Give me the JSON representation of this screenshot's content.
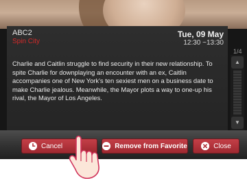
{
  "program_info": {
    "channel": "ABC2",
    "program_title": "Spin City",
    "date": "Tue, 09 May",
    "time_range": "12:30 ~13:30",
    "description": "Charlie and Caitlin struggle to find security in their new relationship. To spite Charlie for downplaying an encounter with an ex, Caitlin accompanies one of New York's ten sexiest men on a business date to make Charlie jealous. Meanwhile, the Mayor plots a way to one-up his rival, the Mayor of Los Angeles.",
    "page_indicator": "1/4"
  },
  "buttons": {
    "cancel": {
      "label": "Cancel",
      "icon": "clock-icon"
    },
    "remove_favorite": {
      "label": "Remove from Favorite",
      "icon": "minus-circle-icon"
    },
    "close": {
      "label": "Close",
      "icon": "x-circle-icon"
    }
  },
  "colors": {
    "program_title": "#d22a2a",
    "button_red": "#b0323a",
    "panel_bg": "#2a2a2a"
  }
}
